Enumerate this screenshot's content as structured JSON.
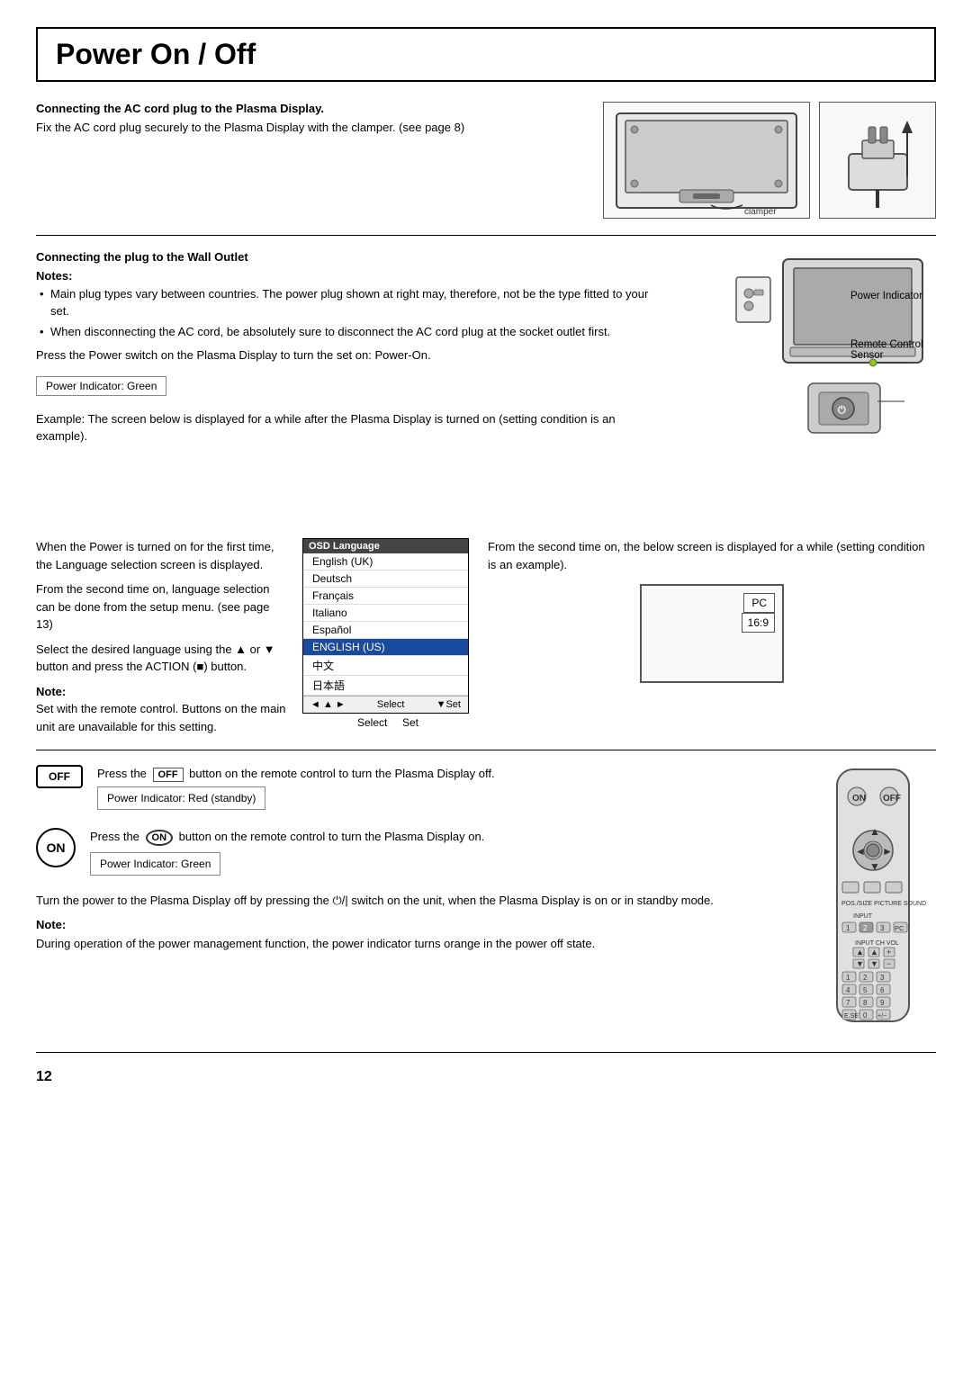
{
  "page": {
    "title": "Power On / Off",
    "page_number": "12"
  },
  "section1": {
    "heading": "Connecting the AC cord plug to the Plasma Display.",
    "body": "Fix the AC cord plug securely to the Plasma Display with the clamper. (see page 8)"
  },
  "section2": {
    "heading": "Connecting the plug to the Wall Outlet",
    "notes_label": "Notes:",
    "bullets": [
      "Main plug types vary between countries. The power plug shown at right may, therefore, not be the type fitted to your set.",
      "When disconnecting the AC cord, be absolutely sure to disconnect the AC cord plug at the socket outlet first."
    ],
    "press_text": "Press the Power switch on the Plasma Display to turn the set on: Power-On.",
    "power_indicator_green": "Power Indicator: Green",
    "example_text": "Example: The screen below is displayed for a while after the Plasma Display is turned on (setting condition is an example).",
    "power_indicator_label": "Power Indicator",
    "remote_control_label": "Remote Control\nSensor"
  },
  "osd": {
    "title": "OSD Language",
    "items": [
      {
        "label": "English (UK)",
        "selected": false
      },
      {
        "label": "Deutsch",
        "selected": false
      },
      {
        "label": "Français",
        "selected": false
      },
      {
        "label": "Italiano",
        "selected": false
      },
      {
        "label": "Español",
        "selected": false
      },
      {
        "label": "ENGLISH (US)",
        "selected": true
      },
      {
        "label": "中文",
        "selected": false
      },
      {
        "label": "日本語",
        "selected": false
      }
    ],
    "footer_select": "Select",
    "footer_set": "Set"
  },
  "bottom_left_text": {
    "para1": "When the Power is turned on for the first time, the Language selection screen is displayed.",
    "para2": "From the second time on, language selection can be done from the setup menu. (see page 13)",
    "para3": "Select the desired language using the ▲ or ▼ button and press the ACTION (■) button.",
    "note_label": "Note:",
    "note_text": "Set with the remote control. Buttons on the main unit are unavailable for this setting."
  },
  "bottom_right_text": {
    "para1": "From the second time on, the below screen is displayed for a while (setting condition is an example)."
  },
  "pc_screen": {
    "pc_label": "PC",
    "ratio_label": "16:9"
  },
  "off_section": {
    "btn_label": "OFF",
    "press_text_before": "Press the",
    "btn_inline": "OFF",
    "press_text_after": "button on the remote control to turn the Plasma Display off.",
    "power_indicator_red": "Power Indicator: Red (standby)"
  },
  "on_section": {
    "btn_label": "ON",
    "press_text_before": "Press the",
    "btn_inline": "ON",
    "press_text_after": "button on the remote control to turn the Plasma Display on.",
    "power_indicator_green": "Power Indicator: Green"
  },
  "turn_off_section": {
    "text": "Turn the power to the Plasma Display off by pressing the ⏻/| switch on the unit, when the Plasma Display is on or in standby mode.",
    "note_label": "Note:",
    "note_text": "During operation of the power management function, the power indicator turns orange in the power off state."
  }
}
